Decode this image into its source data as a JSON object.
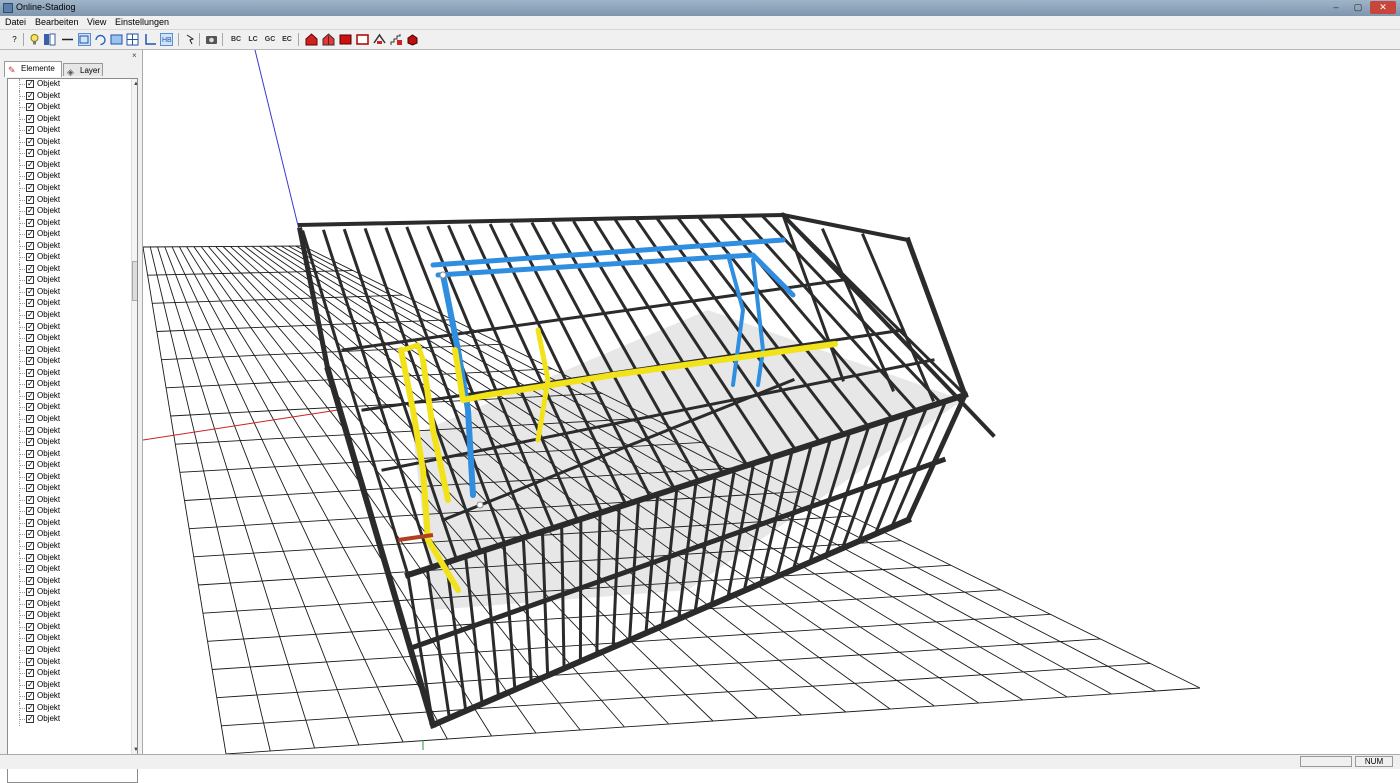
{
  "window": {
    "title": "Online-Stadiog",
    "controls": [
      "–",
      "▢",
      "✕"
    ]
  },
  "menu": [
    "Datei",
    "Bearbeiten",
    "View",
    "Einstellungen"
  ],
  "toolbar": {
    "text_buttons": [
      "BC",
      "LC",
      "GC",
      "EC"
    ]
  },
  "sidepanel": {
    "close": "×",
    "tabs": [
      {
        "label": "Elemente",
        "icon": "elements-icon",
        "active": true
      },
      {
        "label": "Layer",
        "icon": "layer-icon",
        "active": false
      }
    ],
    "tree": {
      "item_label": "Objekt",
      "checked": true,
      "count": 56
    }
  },
  "viewport": {
    "grid_color": "#1a1a1a",
    "axis_x_color": "#cc2222",
    "axis_z_color": "#3a3ad0",
    "frame_color": "#2b2b2b",
    "pipe_blue": "#2f8ee0",
    "pipe_yellow": "#f2e21a"
  },
  "status": {
    "num": "NUM"
  }
}
